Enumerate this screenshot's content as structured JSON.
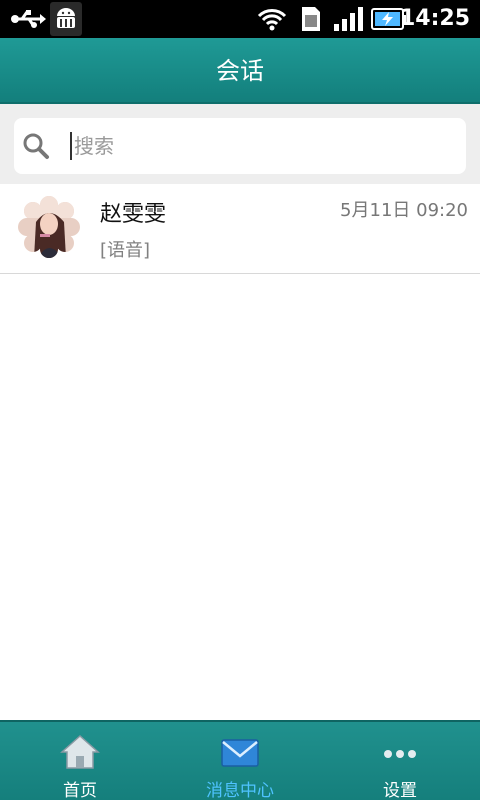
{
  "status_bar": {
    "time": "14:25",
    "icons": [
      "usb-icon",
      "android-debug-icon",
      "wifi-icon",
      "sim-icon",
      "signal-icon",
      "battery-charging-icon"
    ]
  },
  "header": {
    "title": "会话"
  },
  "search": {
    "placeholder": "搜索",
    "value": ""
  },
  "conversations": [
    {
      "name": "赵雯雯",
      "time": "5月11日 09:20",
      "preview": "[语音]"
    }
  ],
  "bottom_nav": {
    "tabs": [
      {
        "label": "首页",
        "icon": "home-icon",
        "active": false
      },
      {
        "label": "消息中心",
        "icon": "envelope-icon",
        "active": true
      },
      {
        "label": "设置",
        "icon": "more-dots-icon",
        "active": false
      }
    ]
  },
  "colors": {
    "accent": "#1a8d8a",
    "active_tab_text": "#4fc3ff",
    "status_bar": "#000000"
  }
}
